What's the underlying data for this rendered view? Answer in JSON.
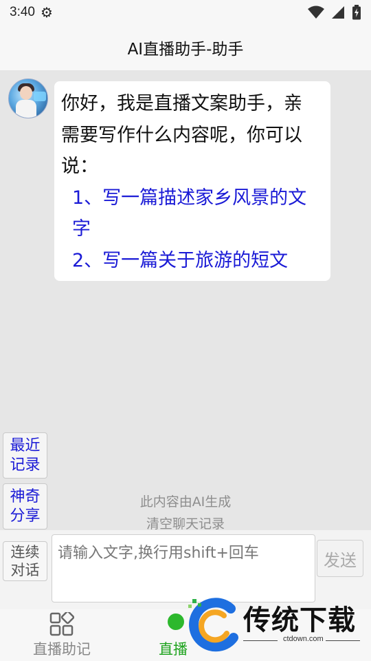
{
  "status_bar": {
    "time": "3:40",
    "icons": [
      "gear-icon",
      "wifi-icon",
      "signal-icon",
      "battery-icon"
    ]
  },
  "title": "AI直播助手-助手",
  "message": {
    "line1": "你好，我是直播文案助手，亲",
    "line2": "需要写作什么内容呢，你可以",
    "line3": "说：",
    "suggestion1_a": "1、写一篇描述家乡风景的文",
    "suggestion1_b": "字",
    "suggestion2": "2、写一篇关于旅游的短文"
  },
  "side_buttons": {
    "recent_line1": "最近",
    "recent_line2": "记录",
    "share_line1": "神奇",
    "share_line2": "分享"
  },
  "ai_note": "此内容由AI生成",
  "clear_history": "清空聊天记录",
  "input": {
    "continue_line1": "连续",
    "continue_line2": "对话",
    "placeholder": "请输入文字,换行用shift+回车",
    "send_label": "发送"
  },
  "bottom_nav": {
    "item1": "直播助记",
    "item2": "直播"
  },
  "watermark": {
    "brand": "传统下载",
    "url": "ctdown.com"
  },
  "colors": {
    "link": "#1a1ad6",
    "active_nav": "#1fa31f",
    "background": "#e6e6e6"
  }
}
